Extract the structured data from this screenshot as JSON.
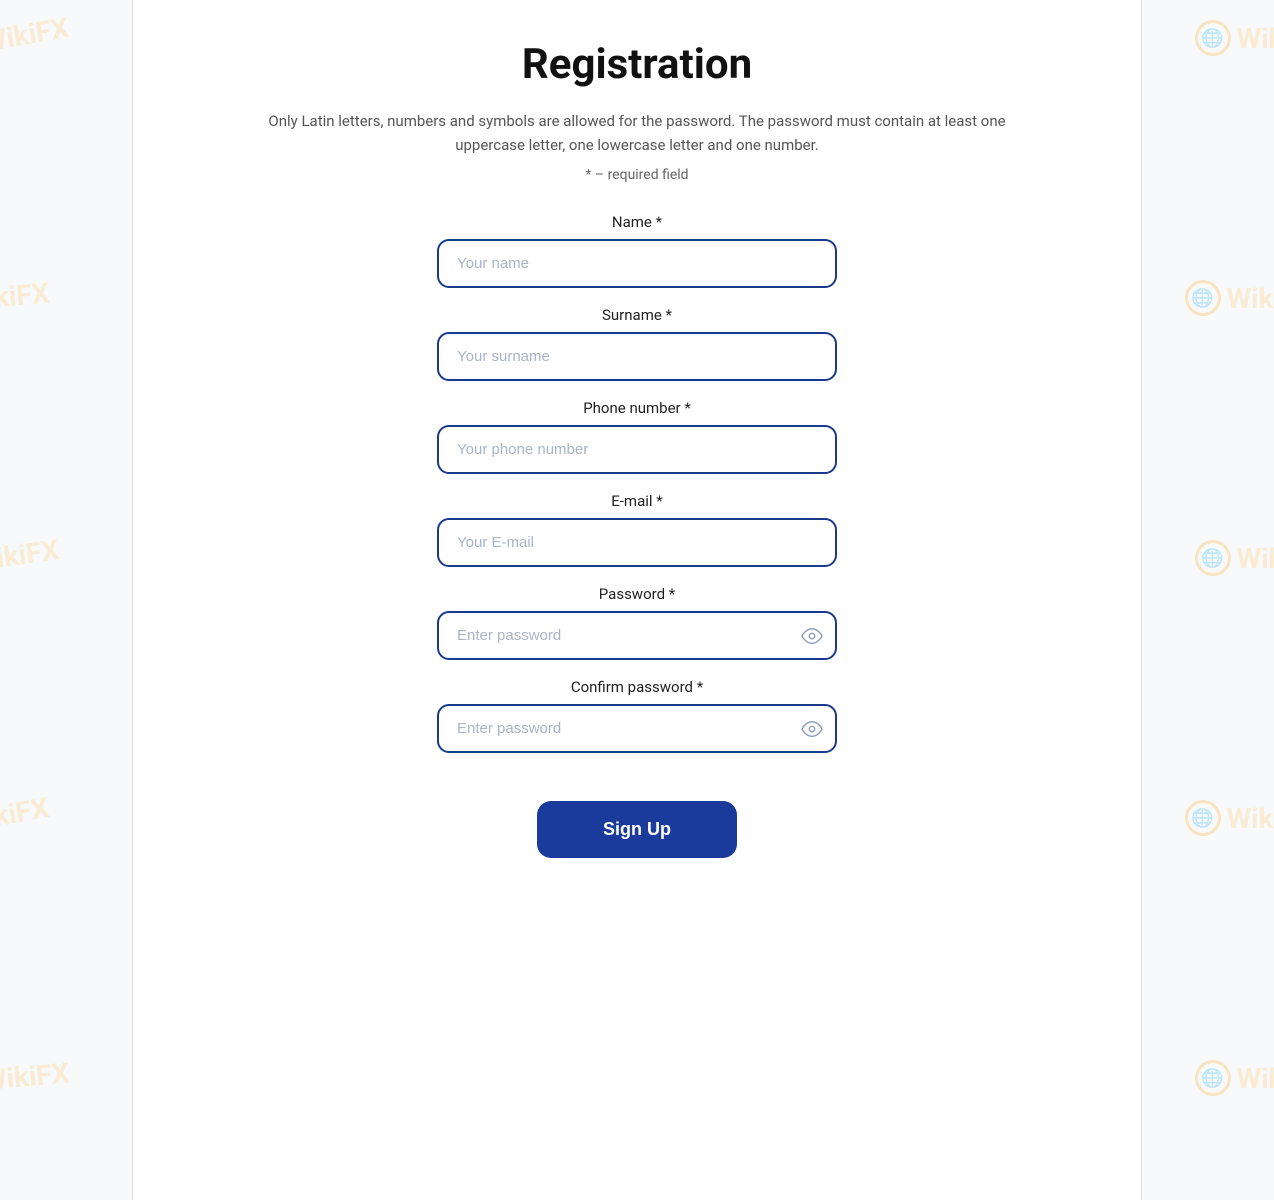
{
  "page": {
    "title": "Registration",
    "description": "Only Latin letters, numbers and symbols are allowed for the password. The password must contain at least one uppercase letter, one lowercase letter and one number.",
    "required_note": "* – required field"
  },
  "form": {
    "name_label": "Name *",
    "name_placeholder": "Your name",
    "surname_label": "Surname *",
    "surname_placeholder": "Your surname",
    "phone_label": "Phone number *",
    "phone_placeholder": "Your phone number",
    "email_label": "E-mail *",
    "email_placeholder": "Your E-mail",
    "password_label": "Password *",
    "password_placeholder": "Enter password",
    "confirm_password_label": "Confirm password *",
    "confirm_password_placeholder": "Enter password",
    "submit_label": "Sign Up"
  },
  "watermark": {
    "text": "WikiFX"
  }
}
